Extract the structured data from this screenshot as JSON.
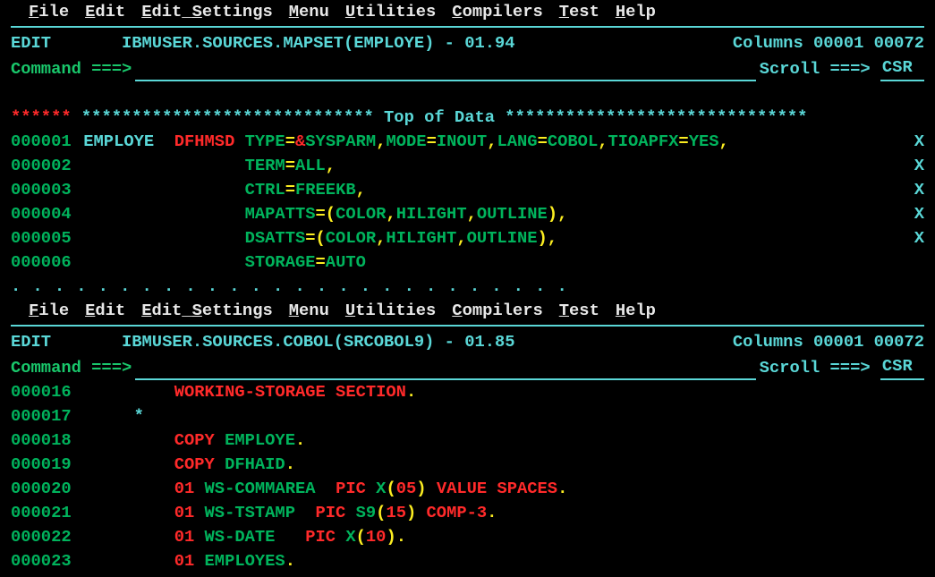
{
  "menu": [
    {
      "hot": "F",
      "rest": "ile"
    },
    {
      "hot": "E",
      "rest": "dit"
    },
    {
      "pre": "E",
      "mid": "dit_",
      "pre2": "",
      "hot2": "S",
      "rest": "ettings"
    },
    {
      "hot": "M",
      "rest": "enu"
    },
    {
      "hot": "U",
      "rest": "tilities"
    },
    {
      "hot": "C",
      "rest": "ompilers"
    },
    {
      "hot": "T",
      "rest": "est"
    },
    {
      "hot": "H",
      "rest": "elp"
    }
  ],
  "panel1": {
    "mode": "EDIT",
    "dataset": "IBMUSER.SOURCES.MAPSET(EMPLOYE) - 01.94",
    "columns_label": "Columns",
    "columns_val": "00001 00072",
    "command_label": "Command ===>",
    "scroll_label": "Scroll ===>",
    "scroll_val": "CSR ",
    "top_stars_left": "******",
    "top_mid": "*****************************",
    "top_label": " Top of Data ",
    "top_right": "******************************",
    "lines": [
      {
        "ln": "000001",
        "seg": [
          {
            "t": " EMPLOYE  ",
            "c": "c-c"
          },
          {
            "t": "DFHMSD ",
            "c": "c-r"
          },
          {
            "t": "TYPE",
            "c": "c-g"
          },
          {
            "t": "=",
            "c": "c-y"
          },
          {
            "t": "&",
            "c": "c-r"
          },
          {
            "t": "SYSPARM",
            "c": "c-g"
          },
          {
            "t": ",",
            "c": "c-y"
          },
          {
            "t": "MODE",
            "c": "c-g"
          },
          {
            "t": "=",
            "c": "c-y"
          },
          {
            "t": "INOUT",
            "c": "c-g"
          },
          {
            "t": ",",
            "c": "c-y"
          },
          {
            "t": "LANG",
            "c": "c-g"
          },
          {
            "t": "=",
            "c": "c-y"
          },
          {
            "t": "COBOL",
            "c": "c-g"
          },
          {
            "t": ",",
            "c": "c-y"
          },
          {
            "t": "TIOAPFX",
            "c": "c-g"
          },
          {
            "t": "=",
            "c": "c-y"
          },
          {
            "t": "YES",
            "c": "c-g"
          },
          {
            "t": ",",
            "c": "c-y"
          }
        ],
        "cont": "X"
      },
      {
        "ln": "000002",
        "seg": [
          {
            "t": "                 ",
            "c": "c-c"
          },
          {
            "t": "TERM",
            "c": "c-g"
          },
          {
            "t": "=",
            "c": "c-y"
          },
          {
            "t": "ALL",
            "c": "c-g"
          },
          {
            "t": ",",
            "c": "c-y"
          }
        ],
        "cont": "X"
      },
      {
        "ln": "000003",
        "seg": [
          {
            "t": "                 ",
            "c": "c-c"
          },
          {
            "t": "CTRL",
            "c": "c-g"
          },
          {
            "t": "=",
            "c": "c-y"
          },
          {
            "t": "FREEKB",
            "c": "c-g"
          },
          {
            "t": ",",
            "c": "c-y"
          }
        ],
        "cont": "X"
      },
      {
        "ln": "000004",
        "seg": [
          {
            "t": "                 ",
            "c": "c-c"
          },
          {
            "t": "MAPATTS",
            "c": "c-g"
          },
          {
            "t": "=(",
            "c": "c-y"
          },
          {
            "t": "COLOR",
            "c": "c-g"
          },
          {
            "t": ",",
            "c": "c-y"
          },
          {
            "t": "HILIGHT",
            "c": "c-g"
          },
          {
            "t": ",",
            "c": "c-y"
          },
          {
            "t": "OUTLINE",
            "c": "c-g"
          },
          {
            "t": "),",
            "c": "c-y"
          }
        ],
        "cont": "X"
      },
      {
        "ln": "000005",
        "seg": [
          {
            "t": "                 ",
            "c": "c-c"
          },
          {
            "t": "DSATTS",
            "c": "c-g"
          },
          {
            "t": "=(",
            "c": "c-y"
          },
          {
            "t": "COLOR",
            "c": "c-g"
          },
          {
            "t": ",",
            "c": "c-y"
          },
          {
            "t": "HILIGHT",
            "c": "c-g"
          },
          {
            "t": ",",
            "c": "c-y"
          },
          {
            "t": "OUTLINE",
            "c": "c-g"
          },
          {
            "t": "),",
            "c": "c-y"
          }
        ],
        "cont": "X"
      },
      {
        "ln": "000006",
        "seg": [
          {
            "t": "                 ",
            "c": "c-c"
          },
          {
            "t": "STORAGE",
            "c": "c-g"
          },
          {
            "t": "=",
            "c": "c-y"
          },
          {
            "t": "AUTO",
            "c": "c-g"
          }
        ],
        "cont": ""
      }
    ],
    "dots": " .  .  .  .  .  .  .  .  .  .  .  .  .  .  .  .  .  .  .  .  .  .  .  .  .  ."
  },
  "panel2": {
    "mode": "EDIT",
    "dataset": "IBMUSER.SOURCES.COBOL(SRCOBOL9) - 01.85",
    "columns_label": "Columns",
    "columns_val": "00001 00072",
    "command_label": "Command ===>",
    "scroll_label": "Scroll ===>",
    "scroll_val": "CSR ",
    "lines": [
      {
        "ln": "000016",
        "seg": [
          {
            "t": "          ",
            "c": "c-c"
          },
          {
            "t": "WORKING-STORAGE SECTION",
            "c": "c-r"
          },
          {
            "t": ".",
            "c": "c-y"
          }
        ]
      },
      {
        "ln": "000017",
        "seg": [
          {
            "t": "      ",
            "c": "c-c"
          },
          {
            "t": "*",
            "c": "c-c"
          }
        ]
      },
      {
        "ln": "000018",
        "seg": [
          {
            "t": "          ",
            "c": "c-c"
          },
          {
            "t": "COPY ",
            "c": "c-r"
          },
          {
            "t": "EMPLOYE",
            "c": "c-g"
          },
          {
            "t": ".",
            "c": "c-y"
          }
        ]
      },
      {
        "ln": "000019",
        "seg": [
          {
            "t": "          ",
            "c": "c-c"
          },
          {
            "t": "COPY ",
            "c": "c-r"
          },
          {
            "t": "DFHAID",
            "c": "c-g"
          },
          {
            "t": ".",
            "c": "c-y"
          }
        ]
      },
      {
        "ln": "000020",
        "seg": [
          {
            "t": "          ",
            "c": "c-c"
          },
          {
            "t": "01 ",
            "c": "c-r"
          },
          {
            "t": "WS-COMMAREA  ",
            "c": "c-g"
          },
          {
            "t": "PIC ",
            "c": "c-r"
          },
          {
            "t": "X",
            "c": "c-g"
          },
          {
            "t": "(",
            "c": "c-y"
          },
          {
            "t": "05",
            "c": "c-r"
          },
          {
            "t": ") ",
            "c": "c-y"
          },
          {
            "t": "VALUE SPACES",
            "c": "c-r"
          },
          {
            "t": ".",
            "c": "c-y"
          }
        ]
      },
      {
        "ln": "000021",
        "seg": [
          {
            "t": "          ",
            "c": "c-c"
          },
          {
            "t": "01 ",
            "c": "c-r"
          },
          {
            "t": "WS-TSTAMP  ",
            "c": "c-g"
          },
          {
            "t": "PIC ",
            "c": "c-r"
          },
          {
            "t": "S9",
            "c": "c-g"
          },
          {
            "t": "(",
            "c": "c-y"
          },
          {
            "t": "15",
            "c": "c-r"
          },
          {
            "t": ") ",
            "c": "c-y"
          },
          {
            "t": "COMP-3",
            "c": "c-r"
          },
          {
            "t": ".",
            "c": "c-y"
          }
        ]
      },
      {
        "ln": "000022",
        "seg": [
          {
            "t": "          ",
            "c": "c-c"
          },
          {
            "t": "01 ",
            "c": "c-r"
          },
          {
            "t": "WS-DATE   ",
            "c": "c-g"
          },
          {
            "t": "PIC ",
            "c": "c-r"
          },
          {
            "t": "X",
            "c": "c-g"
          },
          {
            "t": "(",
            "c": "c-y"
          },
          {
            "t": "10",
            "c": "c-r"
          },
          {
            "t": ")",
            "c": "c-y"
          },
          {
            "t": ".",
            "c": "c-y"
          }
        ]
      },
      {
        "ln": "000023",
        "seg": [
          {
            "t": "          ",
            "c": "c-c"
          },
          {
            "t": "01 ",
            "c": "c-r"
          },
          {
            "t": "EMPLOYES",
            "c": "c-g"
          },
          {
            "t": ".",
            "c": "c-y"
          }
        ]
      }
    ]
  }
}
